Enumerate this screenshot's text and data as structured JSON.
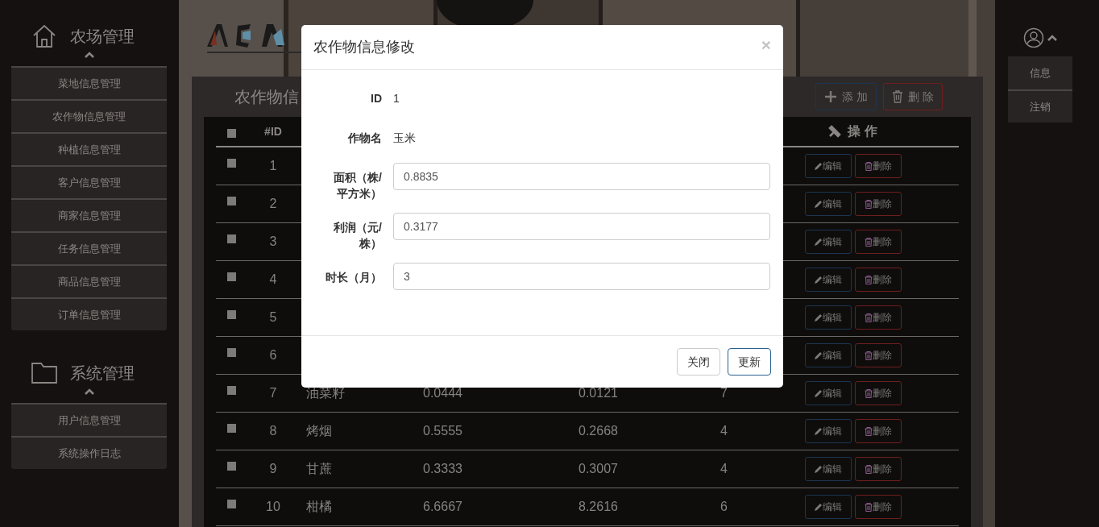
{
  "sidebar": {
    "sections": [
      {
        "kind": "home",
        "title": "农场管理",
        "expanded": true,
        "items": [
          "菜地信息管理",
          "农作物信息管理",
          "种植信息管理",
          "客户信息管理",
          "商家信息管理",
          "任务信息管理",
          "商品信息管理",
          "订单信息管理"
        ]
      },
      {
        "kind": "folder",
        "title": "系统管理",
        "expanded": true,
        "items": [
          "用户信息管理",
          "系统操作日志"
        ]
      }
    ]
  },
  "user_menu": {
    "expanded": true,
    "items": [
      "信息",
      "注销"
    ]
  },
  "panel": {
    "title": "农作物信",
    "buttons": [
      {
        "kind": "add",
        "label": "添 加"
      },
      {
        "kind": "delete",
        "label": "删 除"
      }
    ]
  },
  "table": {
    "header": {
      "checked": false,
      "id": "#ID",
      "actions": "操 作"
    },
    "rows": [
      {
        "checked": false,
        "id": "1",
        "edit": "编辑",
        "delete": "删除"
      },
      {
        "checked": false,
        "id": "2",
        "edit": "编辑",
        "delete": "删除"
      },
      {
        "checked": false,
        "id": "3",
        "edit": "编辑",
        "delete": "删除"
      },
      {
        "checked": false,
        "id": "4",
        "edit": "编辑",
        "delete": "删除"
      },
      {
        "checked": false,
        "id": "5",
        "edit": "编辑",
        "delete": "删除"
      },
      {
        "checked": false,
        "id": "6",
        "edit": "编辑",
        "delete": "删除"
      },
      {
        "checked": false,
        "id": "7",
        "name": "油菜籽",
        "area": "0.0444",
        "profit": "0.0121",
        "months": "7",
        "edit": "编辑",
        "delete": "删除"
      },
      {
        "checked": false,
        "id": "8",
        "name": "烤烟",
        "area": "0.5555",
        "profit": "0.2668",
        "months": "4",
        "edit": "编辑",
        "delete": "删除"
      },
      {
        "checked": false,
        "id": "9",
        "name": "甘蔗",
        "area": "0.3333",
        "profit": "0.3007",
        "months": "4",
        "edit": "编辑",
        "delete": "删除"
      },
      {
        "checked": false,
        "id": "10",
        "name": "柑橘",
        "area": "6.6667",
        "profit": "8.2616",
        "months": "6",
        "edit": "编辑",
        "delete": "删除"
      }
    ]
  },
  "modal": {
    "title": "农作物信息修改",
    "close": "×",
    "fields": [
      {
        "kind": "static",
        "label": "ID",
        "value": "1"
      },
      {
        "kind": "static",
        "label": "作物名",
        "value": "玉米"
      },
      {
        "kind": "input",
        "label": "面积（株/平方米）",
        "value": "0.8835"
      },
      {
        "kind": "input",
        "label": "利润（元/株）",
        "value": "0.3177"
      },
      {
        "kind": "input",
        "label": "时长（月）",
        "value": "3"
      }
    ],
    "buttons": [
      {
        "kind": "default",
        "label": "关闭"
      },
      {
        "kind": "primary",
        "label": "更新"
      }
    ]
  }
}
